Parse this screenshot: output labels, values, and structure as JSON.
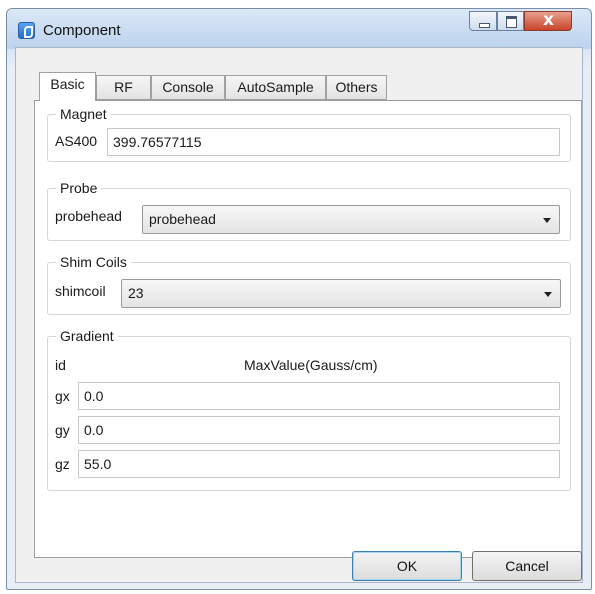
{
  "window": {
    "title": "Component"
  },
  "tabs": [
    {
      "label": "Basic"
    },
    {
      "label": "RF"
    },
    {
      "label": "Console"
    },
    {
      "label": "AutoSample"
    },
    {
      "label": "Others"
    }
  ],
  "active_tab": "Basic",
  "magnet": {
    "group_title": "Magnet",
    "label": "AS400",
    "value": "399.76577115"
  },
  "probe": {
    "group_title": "Probe",
    "label": "probehead",
    "selected": "probehead"
  },
  "shim": {
    "group_title": "Shim Coils",
    "label": "shimcoil",
    "selected": "23"
  },
  "gradient": {
    "group_title": "Gradient",
    "col_id": "id",
    "col_value": "MaxValue(Gauss/cm)",
    "rows": [
      {
        "id": "gx",
        "value": "0.0"
      },
      {
        "id": "gy",
        "value": "0.0"
      },
      {
        "id": "gz",
        "value": "55.0"
      }
    ]
  },
  "buttons": {
    "ok": "OK",
    "cancel": "Cancel"
  }
}
